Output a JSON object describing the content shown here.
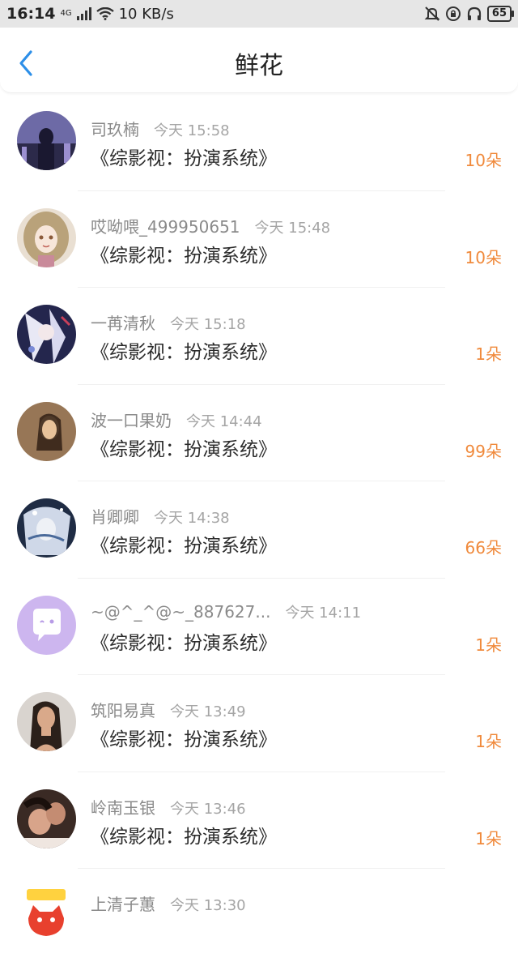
{
  "status_bar": {
    "time": "16:14",
    "network": "4G",
    "speed": "10 KB/s",
    "battery": "65"
  },
  "header": {
    "title": "鲜花"
  },
  "items": [
    {
      "name": "司玖楠",
      "time": "今天 15:58",
      "book": "《综影视：扮演系统》",
      "count": "10朵",
      "avatar": "avatar-night-city"
    },
    {
      "name": "哎呦喂_499950651",
      "time": "今天 15:48",
      "book": "《综影视：扮演系统》",
      "count": "10朵",
      "avatar": "avatar-anime-girl"
    },
    {
      "name": "一苒清秋",
      "time": "今天 15:18",
      "book": "《综影视：扮演系统》",
      "count": "1朵",
      "avatar": "avatar-anime-white-hair"
    },
    {
      "name": "波一口果奶",
      "time": "今天 14:44",
      "book": "《综影视：扮演系统》",
      "count": "99朵",
      "avatar": "avatar-sepia-portrait"
    },
    {
      "name": "肖卿卿",
      "time": "今天 14:38",
      "book": "《综影视：扮演系统》",
      "count": "66朵",
      "avatar": "avatar-fantasy-art"
    },
    {
      "name": "~@^_^@~_887627...",
      "time": "今天 14:11",
      "book": "《综影视：扮演系统》",
      "count": "1朵",
      "avatar": "avatar-default-chat"
    },
    {
      "name": "筑阳易真",
      "time": "今天 13:49",
      "book": "《综影视：扮演系统》",
      "count": "1朵",
      "avatar": "avatar-woman-photo"
    },
    {
      "name": "岭南玉银",
      "time": "今天 13:46",
      "book": "《综影视：扮演系统》",
      "count": "1朵",
      "avatar": "avatar-couple-photo"
    },
    {
      "name": "上清子蕙",
      "time": "今天 13:30",
      "book": "",
      "count": "",
      "avatar": "avatar-cartoon-cat"
    }
  ]
}
